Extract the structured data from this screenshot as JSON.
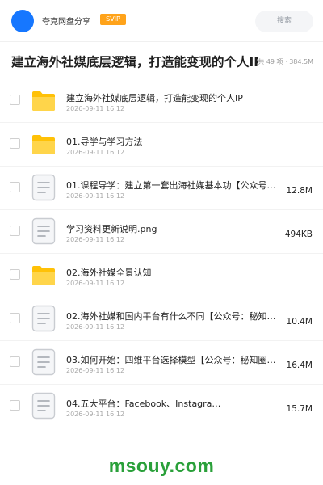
{
  "header": {
    "app_name": "夸克网盘分享",
    "badge": "SVIP",
    "search_placeholder": "搜索",
    "avatar_color": "#1677ff",
    "badge_color": "#ffa31a"
  },
  "title_row": {
    "title": "建立海外社媒底层逻辑，打造能变现的个人IP",
    "meta": "共 49 项 · 384.5M"
  },
  "files": [
    {
      "type": "folder",
      "name": "建立海外社媒底层逻辑，打造能变现的个人IP",
      "date": "2026-09-11 16:12",
      "size": ""
    },
    {
      "type": "folder",
      "name": "01.导学与学习方法",
      "date": "2026-09-11 16:12",
      "size": ""
    },
    {
      "type": "doc",
      "name": "01.课程导学：建立第一套出海社媒基本功【公众号：…",
      "date": "2026-09-11 16:12",
      "size": "12.8M"
    },
    {
      "type": "doc",
      "name": "学习资料更新说明.png",
      "date": "2026-09-11 16:12",
      "size": "494KB"
    },
    {
      "type": "folder",
      "name": "02.海外社媒全景认知",
      "date": "2026-09-11 16:12",
      "size": ""
    },
    {
      "type": "doc",
      "name": "02.海外社媒和国内平台有什么不同【公众号：秘知圈…",
      "date": "2026-09-11 16:12",
      "size": "10.4M"
    },
    {
      "type": "doc",
      "name": "03.如何开始：四维平台选择模型【公众号：秘知圈】…",
      "date": "2026-09-11 16:12",
      "size": "16.4M"
    },
    {
      "type": "doc",
      "name": "04.五大平台：Facebook、Instagra…",
      "date": "2026-09-11 16:12",
      "size": "15.7M"
    }
  ],
  "footer": {
    "watermark": "msouy.com",
    "watermark_color": "#2aa03a"
  },
  "icons": {
    "folder": "folder-icon",
    "doc": "document-icon"
  }
}
